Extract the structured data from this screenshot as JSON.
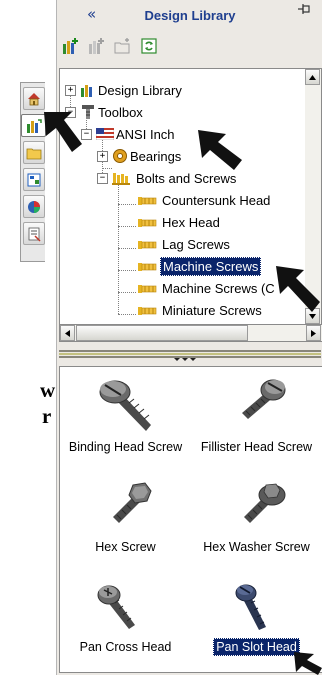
{
  "panel": {
    "title": "Design Library",
    "collapse_glyph": "«",
    "pin_glyph": "⊣"
  },
  "toolbar": {
    "buttons": [
      "add-to-library-icon",
      "add-file-location-icon",
      "create-new-folder-icon",
      "refresh-icon"
    ]
  },
  "side_tabs": [
    "home-icon",
    "design-library-icon",
    "file-explorer-icon",
    "view-palette-icon",
    "appearances-icon",
    "custom-properties-icon"
  ],
  "tree": {
    "items": [
      {
        "label": "Design Library",
        "expander": "+"
      },
      {
        "label": "Toolbox",
        "expander": "−"
      },
      {
        "label": "ANSI Inch",
        "expander": "−"
      },
      {
        "label": "Bearings",
        "expander": "+"
      },
      {
        "label": "Bolts and Screws",
        "expander": "−"
      },
      {
        "label": "Countersunk Head"
      },
      {
        "label": "Hex Head"
      },
      {
        "label": "Lag Screws"
      },
      {
        "label": "Machine Screws"
      },
      {
        "label": "Machine Screws (C"
      },
      {
        "label": "Miniature Screws"
      }
    ]
  },
  "preview": {
    "items": [
      {
        "label": "Binding Head Screw"
      },
      {
        "label": "Fillister Head Screw"
      },
      {
        "label": "Hex Screw"
      },
      {
        "label": "Hex Washer Screw"
      },
      {
        "label": "Pan Cross Head"
      },
      {
        "label": "Pan Slot Head"
      }
    ]
  },
  "gutter_text": [
    "w",
    "r"
  ],
  "colors": {
    "selection": "#0a246a",
    "title_text": "#1f3f8f",
    "panel_bg": "#ece9e4"
  }
}
